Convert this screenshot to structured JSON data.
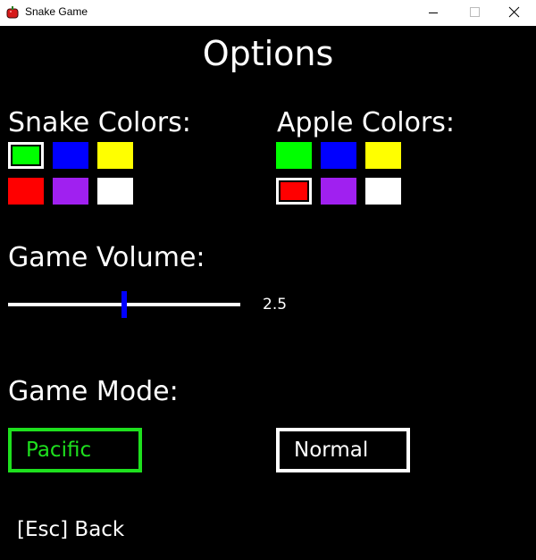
{
  "window": {
    "title": "Snake Game",
    "app_icon": "apple-icon",
    "controls": [
      "minimize-icon",
      "maximize-icon",
      "close-icon"
    ]
  },
  "page": {
    "title": "Options"
  },
  "snake_colors": {
    "label": "Snake Colors:",
    "swatches": [
      "#00ff00",
      "#0000ff",
      "#ffff00",
      "#ff0000",
      "#a020f0",
      "#ffffff"
    ],
    "selected": "#00ff00"
  },
  "apple_colors": {
    "label": "Apple Colors:",
    "swatches": [
      "#00ff00",
      "#0000ff",
      "#ffff00",
      "#ff0000",
      "#a020f0",
      "#ffffff"
    ],
    "selected": "#ff0000"
  },
  "volume": {
    "label": "Game Volume:",
    "value": "2.5",
    "level_fraction": 0.5,
    "thumb_color": "#0000ff"
  },
  "game_mode": {
    "label": "Game Mode:",
    "options": [
      "Pacific",
      "Normal"
    ],
    "selected": "Pacific",
    "active_color": "#1ee01e"
  },
  "back": {
    "label": "[Esc] Back"
  }
}
